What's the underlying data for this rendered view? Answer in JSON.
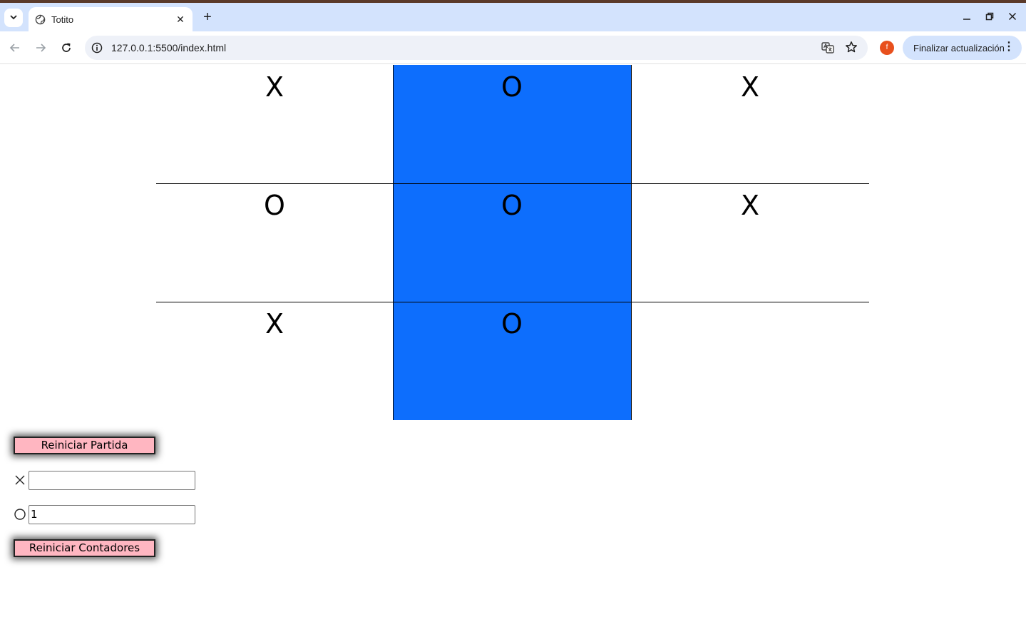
{
  "browser": {
    "tab_title": "Totito",
    "url": "127.0.0.1:5500/index.html",
    "update_button_label": "Finalizar actualización",
    "profile_initial": "f",
    "new_tab_symbol": "+",
    "tab_close_symbol": "✕"
  },
  "board": {
    "cells": [
      {
        "mark": "X",
        "highlighted": false
      },
      {
        "mark": "O",
        "highlighted": true
      },
      {
        "mark": "X",
        "highlighted": false
      },
      {
        "mark": "O",
        "highlighted": false
      },
      {
        "mark": "O",
        "highlighted": true
      },
      {
        "mark": "X",
        "highlighted": false
      },
      {
        "mark": "X",
        "highlighted": false
      },
      {
        "mark": "O",
        "highlighted": true
      },
      {
        "mark": "",
        "highlighted": false
      }
    ],
    "highlight_color": "#0d6efd"
  },
  "controls": {
    "reset_game_label": "Reiniciar Partida",
    "reset_counters_label": "Reiniciar Contadores",
    "x_score": "",
    "o_score": "1",
    "button_color": "#ffb6c1"
  }
}
